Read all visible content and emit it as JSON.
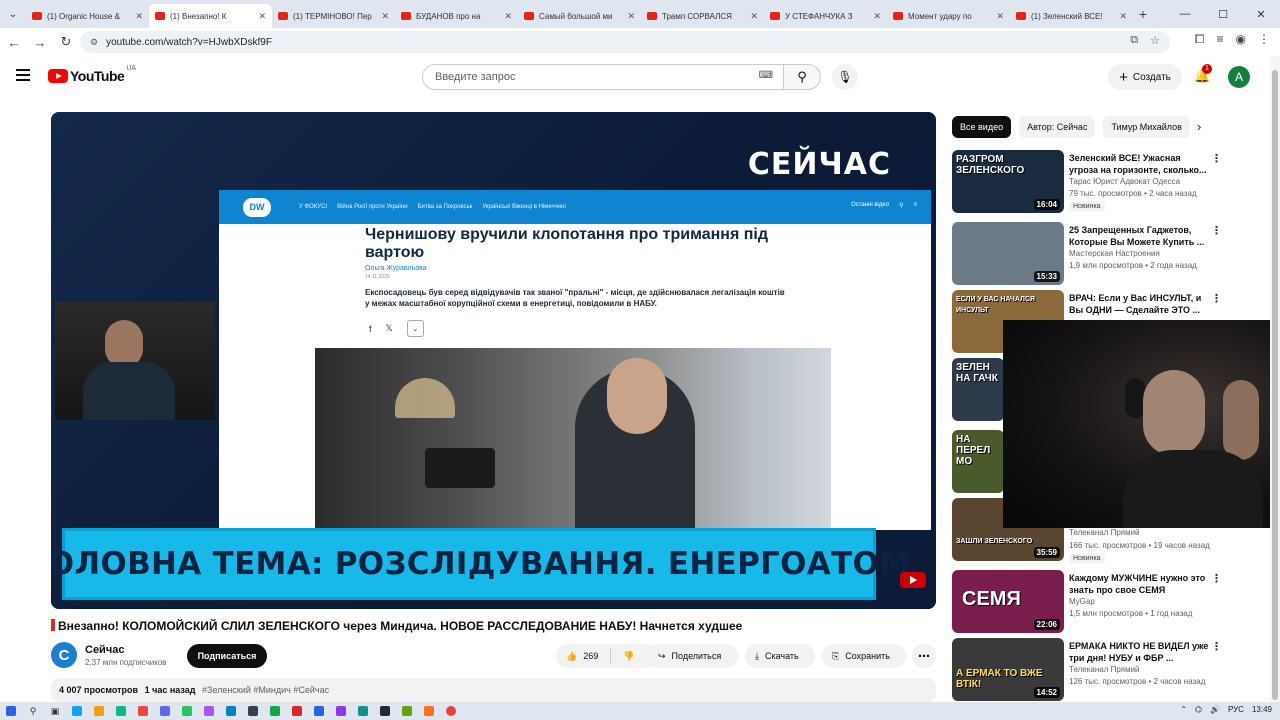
{
  "browser": {
    "tabs": [
      {
        "title": "(1) Organic House &",
        "active": false
      },
      {
        "title": "(1) Внезапно! К",
        "active": true
      },
      {
        "title": "(1) ТЕРМІНОВО! Пер",
        "active": false
      },
      {
        "title": "БУДАНОВ про на",
        "active": false
      },
      {
        "title": "Самый большой ми",
        "active": false
      },
      {
        "title": "Трамп СОРВАЛСЯ",
        "active": false
      },
      {
        "title": "У СТЕФАНЧУКА З",
        "active": false
      },
      {
        "title": "Момент удару по",
        "active": false
      },
      {
        "title": "(1) Зеленский ВСЕ!",
        "active": false
      }
    ],
    "url": "youtube.com/watch?v=HJwbXDskf9F"
  },
  "header": {
    "logo_text": "YouTube",
    "region": "UA",
    "search_placeholder": "Введите запрос",
    "create_label": "Создать",
    "notification_count": "1",
    "avatar_letter": "A"
  },
  "video": {
    "overlay_channel": "СЕЙЧАС",
    "lower_third": "ГОЛОВНА ТЕМА: РОЗСЛІДУВАННЯ. ЕНЕРГОАТОМ",
    "article": {
      "logo": "DW",
      "nav": [
        "У ФОКУСІ",
        "Війна Росії проти України",
        "Битва за Покровськ",
        "Українські біженці в Німеччині"
      ],
      "nav_right": "Останні відео",
      "title": "Чернишову вручили клопотання про тримання під вартою",
      "author": "Ольга Журавльова",
      "date": "14.11.2025",
      "lead": "Експосадовець був серед відвідувачів так званої \"пральні\" - місця, де здійснювалася легалізація коштів у межах масштабної корупційної схеми в енергетиці, повідомили в НАБУ."
    }
  },
  "watch": {
    "title": "Внезапно! КОЛОМОЙСКИЙ СЛИЛ ЗЕЛЕНСКОГО через Миндича. НОВОЕ РАССЛЕДОВАНИЕ НАБУ! Начнется худшее",
    "channel_name": "Сейчас",
    "channel_initial": "С",
    "subscribers": "2,37 млн подписчиков",
    "subscribe_label": "Подписаться",
    "likes": "269",
    "share_label": "Поделиться",
    "download_label": "Скачать",
    "save_label": "Сохранить",
    "views": "4 007 просмотров",
    "time_ago": "1 час назад",
    "hashtags": "#Зеленский #Миндич #Сейчас"
  },
  "sidebar": {
    "chips": [
      "Все видео",
      "Автор: Сейчас",
      "Тимур Михайлов"
    ],
    "recommendations": [
      {
        "title": "Зеленский ВСЕ! Ужасная угроза на горизонте, сколько...",
        "channel": "Тарас Юрист Адвокат Одесса",
        "meta": "79 тыс. просмотров • 2 часа назад",
        "badge": "Новинка",
        "duration": "16:04",
        "thumb_text": "РАЗГРОМ ЗЕЛЕНСКОГО",
        "color": "#1b2b3f"
      },
      {
        "title": "25 Запрещенных Гаджетов, Которые Вы Можете Купить ...",
        "channel": "Мастерская Настроения",
        "meta": "1,9 млн просмотров • 2 года назад",
        "badge": "",
        "duration": "15:33",
        "thumb_text": "",
        "color": "#6b7a85"
      },
      {
        "title": "ВРАЧ: Если у Вас ИНСУЛЬТ, и Вы ОДНИ — Сделайте ЭТО ...",
        "channel": "",
        "meta": "",
        "badge": "",
        "duration": "",
        "thumb_text": "ЕСЛИ У ВАС НАЧАЛСЯ ИНСУЛЬТ",
        "color": "#8a6a3a"
      },
      {
        "title": "",
        "channel": "",
        "meta": "",
        "badge": "",
        "duration": "",
        "thumb_text": "ЗЕЛЕН НА ГАЧК",
        "color": "#2c3a4a"
      },
      {
        "title": "",
        "channel": "",
        "meta": "",
        "badge": "",
        "duration": "",
        "thumb_text": "НА ПЕРЕЛ МО",
        "color": "#4a5a2a"
      },
      {
        "title": "",
        "channel": "Телеканал Прямий",
        "meta": "166 тыс. просмотров • 19 часов назад",
        "badge": "Новинка",
        "duration": "35:59",
        "thumb_text": "ЗАШЛИ ЗЕЛЕНСКОГО",
        "color": "#5a4630"
      },
      {
        "title": "Каждому МУЖЧИНЕ нужно это знать про свое СЕМЯ",
        "channel": "MyGap",
        "meta": "1,5 млн просмотров • 1 год назад",
        "badge": "",
        "duration": "22:06",
        "thumb_text": "СЕМЯ",
        "color": "#7a1e4e"
      },
      {
        "title": "ЕРМАКА НИКТО НЕ ВИДЕЛ уже три дня! НУБУ и ФБР ...",
        "channel": "Телеканал Прямий",
        "meta": "126 тыс. просмотров • 2 часов назад",
        "badge": "",
        "duration": "14:52",
        "thumb_text": "А ЕРМАК ТО ВЖЕ ВТІК!",
        "color": "#3a3a3a"
      }
    ]
  },
  "taskbar": {
    "lang": "РУС",
    "time": "13:49"
  }
}
